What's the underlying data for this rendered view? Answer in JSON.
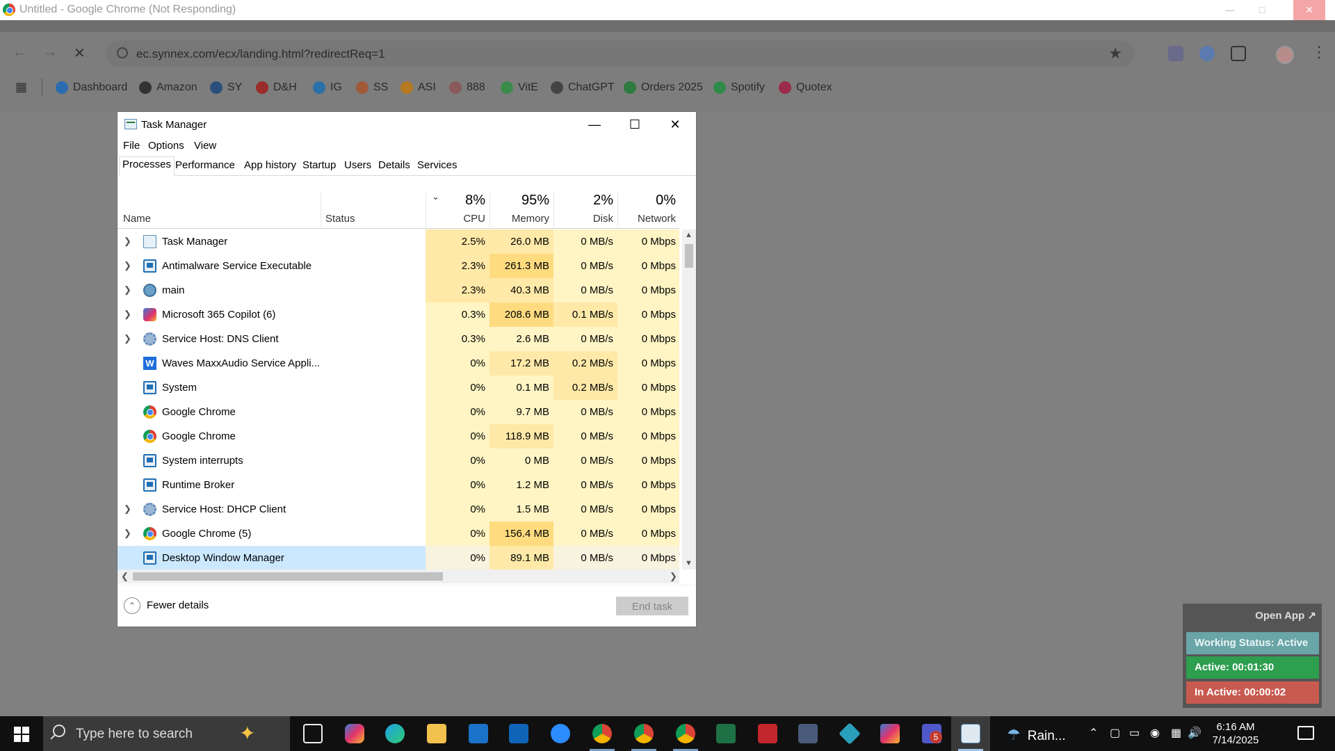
{
  "chrome": {
    "title": "Untitled - Google Chrome (Not Responding)",
    "url": "ec.synnex.com/ecx/landing.html?redirectReq=1",
    "bookmarks": [
      {
        "label": "Dashboard",
        "color": "#2b6cb0"
      },
      {
        "label": "Amazon",
        "color": "#333333"
      },
      {
        "label": "SY",
        "color": "#2a4f7a"
      },
      {
        "label": "D&H",
        "color": "#9b2c2c"
      },
      {
        "label": "IG",
        "color": "#2a6fa8"
      },
      {
        "label": "SS",
        "color": "#a05a3a"
      },
      {
        "label": "ASI",
        "color": "#b7791f"
      },
      {
        "label": "888",
        "color": "#8a5a5a"
      },
      {
        "label": "VitE",
        "color": "#3a8a4a"
      },
      {
        "label": "ChatGPT",
        "color": "#444444"
      },
      {
        "label": "Orders 2025",
        "color": "#2f7a3f"
      },
      {
        "label": "Spotify",
        "color": "#2f8a4a"
      },
      {
        "label": "Quotex",
        "color": "#9a2b4a"
      }
    ]
  },
  "task_manager": {
    "title": "Task Manager",
    "menu": [
      "File",
      "Options",
      "View"
    ],
    "tabs": [
      "Processes",
      "Performance",
      "App history",
      "Startup",
      "Users",
      "Details",
      "Services"
    ],
    "active_tab": "Processes",
    "columns": {
      "name": "Name",
      "status": "Status",
      "cpu": {
        "pct": "8%",
        "label": "CPU"
      },
      "memory": {
        "pct": "95%",
        "label": "Memory"
      },
      "disk": {
        "pct": "2%",
        "label": "Disk"
      },
      "network": {
        "pct": "0%",
        "label": "Network"
      }
    },
    "processes": [
      {
        "name": "Task Manager",
        "icon": "task-manager-icon",
        "expandable": true,
        "cpu": "2.5%",
        "memory": "26.0 MB",
        "disk": "0 MB/s",
        "network": "0 Mbps"
      },
      {
        "name": "Antimalware Service Executable",
        "icon": "app-window-icon",
        "expandable": true,
        "cpu": "2.3%",
        "memory": "261.3 MB",
        "disk": "0 MB/s",
        "network": "0 Mbps"
      },
      {
        "name": "main",
        "icon": "main-app-icon",
        "expandable": true,
        "cpu": "2.3%",
        "memory": "40.3 MB",
        "disk": "0 MB/s",
        "network": "0 Mbps"
      },
      {
        "name": "Microsoft 365 Copilot (6)",
        "icon": "copilot-icon",
        "expandable": true,
        "cpu": "0.3%",
        "memory": "208.6 MB",
        "disk": "0.1 MB/s",
        "network": "0 Mbps"
      },
      {
        "name": "Service Host: DNS Client",
        "icon": "gear-icon",
        "expandable": true,
        "cpu": "0.3%",
        "memory": "2.6 MB",
        "disk": "0 MB/s",
        "network": "0 Mbps"
      },
      {
        "name": "Waves MaxxAudio Service Appli...",
        "icon": "waves-icon",
        "expandable": false,
        "cpu": "0%",
        "memory": "17.2 MB",
        "disk": "0.2 MB/s",
        "network": "0 Mbps"
      },
      {
        "name": "System",
        "icon": "app-window-icon",
        "expandable": false,
        "cpu": "0%",
        "memory": "0.1 MB",
        "disk": "0.2 MB/s",
        "network": "0 Mbps"
      },
      {
        "name": "Google Chrome",
        "icon": "chrome-icon",
        "expandable": false,
        "cpu": "0%",
        "memory": "9.7 MB",
        "disk": "0 MB/s",
        "network": "0 Mbps"
      },
      {
        "name": "Google Chrome",
        "icon": "chrome-icon",
        "expandable": false,
        "cpu": "0%",
        "memory": "118.9 MB",
        "disk": "0 MB/s",
        "network": "0 Mbps"
      },
      {
        "name": "System interrupts",
        "icon": "app-window-icon",
        "expandable": false,
        "cpu": "0%",
        "memory": "0 MB",
        "disk": "0 MB/s",
        "network": "0 Mbps"
      },
      {
        "name": "Runtime Broker",
        "icon": "app-window-icon",
        "expandable": false,
        "cpu": "0%",
        "memory": "1.2 MB",
        "disk": "0 MB/s",
        "network": "0 Mbps"
      },
      {
        "name": "Service Host: DHCP Client",
        "icon": "gear-icon",
        "expandable": true,
        "cpu": "0%",
        "memory": "1.5 MB",
        "disk": "0 MB/s",
        "network": "0 Mbps"
      },
      {
        "name": "Google Chrome (5)",
        "icon": "chrome-icon",
        "expandable": true,
        "cpu": "0%",
        "memory": "156.4 MB",
        "disk": "0 MB/s",
        "network": "0 Mbps"
      },
      {
        "name": "Desktop Window Manager",
        "icon": "app-window-icon",
        "expandable": false,
        "cpu": "0%",
        "memory": "89.1 MB",
        "disk": "0 MB/s",
        "network": "0 Mbps",
        "selected": true
      }
    ],
    "footer": {
      "fewer_details": "Fewer details",
      "end_task": "End task"
    }
  },
  "widget": {
    "open_app": "Open App ↗",
    "working_status": "Working Status: Active",
    "active": "Active: 00:01:30",
    "inactive": "In Active: 00:00:02"
  },
  "taskbar": {
    "search_placeholder": "Type here to search",
    "weather": "Rain...",
    "time": "6:16 AM",
    "date": "7/14/2025",
    "teams_badge": "5"
  }
}
